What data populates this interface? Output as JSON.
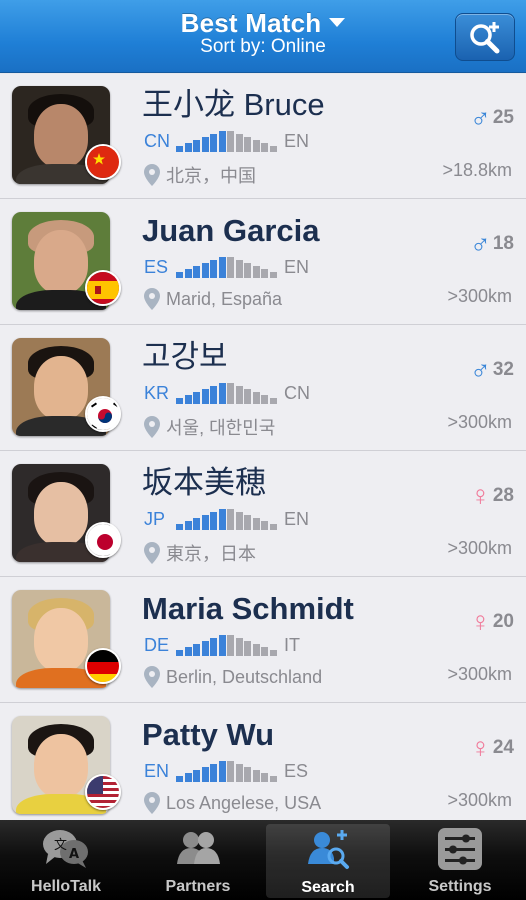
{
  "header": {
    "title": "Best Match",
    "subtitle": "Sort by: Online"
  },
  "users": [
    {
      "name": "王小龙 Bruce",
      "native": "CN",
      "learning": "EN",
      "location": "北京，中国",
      "gender": "male",
      "age": "25",
      "distance": ">18.8km",
      "flag": "cn"
    },
    {
      "name": "Juan Garcia",
      "native": "ES",
      "learning": "EN",
      "location": "Marid, España",
      "gender": "male",
      "age": "18",
      "distance": ">300km",
      "flag": "es"
    },
    {
      "name": "고강보",
      "native": "KR",
      "learning": "CN",
      "location": "서울, 대한민국",
      "gender": "male",
      "age": "32",
      "distance": ">300km",
      "flag": "kr"
    },
    {
      "name": "坂本美穂",
      "native": "JP",
      "learning": "EN",
      "location": "東京，日本",
      "gender": "female",
      "age": "28",
      "distance": ">300km",
      "flag": "jp"
    },
    {
      "name": "Maria Schmidt",
      "native": "DE",
      "learning": "IT",
      "location": "Berlin, Deutschland",
      "gender": "female",
      "age": "20",
      "distance": ">300km",
      "flag": "de"
    },
    {
      "name": "Patty Wu",
      "native": "EN",
      "learning": "ES",
      "location": "Los Angelese, USA",
      "gender": "female",
      "age": "24",
      "distance": ">300km",
      "flag": "us"
    }
  ],
  "tabs": [
    {
      "label": "HelloTalk",
      "icon": "chat-bubbles-icon"
    },
    {
      "label": "Partners",
      "icon": "people-icon"
    },
    {
      "label": "Search",
      "icon": "search-user-icon",
      "active": true
    },
    {
      "label": "Settings",
      "icon": "sliders-icon"
    }
  ],
  "colors": {
    "header": "#1f7fd6",
    "male": "#3a86d8",
    "female": "#f07a9a",
    "native_bar": "#3b82d9",
    "learning_bar": "#a8a8ae"
  }
}
